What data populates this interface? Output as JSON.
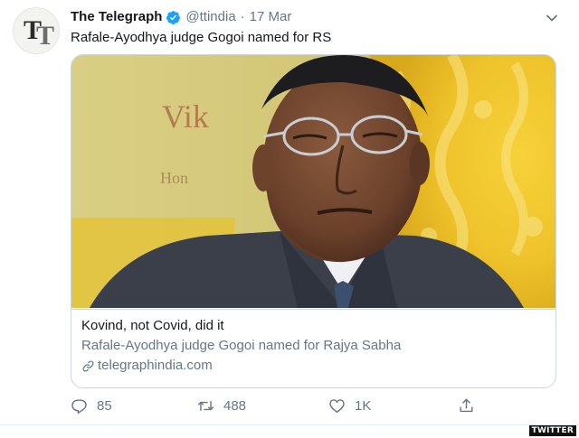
{
  "account": {
    "name": "The Telegraph",
    "handle": "@ttindia",
    "separator": "·",
    "date": "17 Mar",
    "avatar_letters": "TT"
  },
  "tweet": {
    "text": "Rafale-Ayodhya judge Gogoi named for RS"
  },
  "card": {
    "title": "Kovind, not Covid, did it",
    "description": "Rafale-Ayodhya judge Gogoi named for Rajya Sabha",
    "domain": "telegraphindia.com"
  },
  "actions": {
    "replies": "85",
    "retweets": "488",
    "likes": "1K"
  },
  "watermark": "TWITTER",
  "colors": {
    "verified": "#1da1f2",
    "secondary_text": "#657786",
    "border": "#ccd6dd"
  },
  "icons": [
    "verified-badge-icon",
    "chevron-down-icon",
    "link-icon",
    "reply-icon",
    "retweet-icon",
    "like-icon",
    "share-icon"
  ]
}
